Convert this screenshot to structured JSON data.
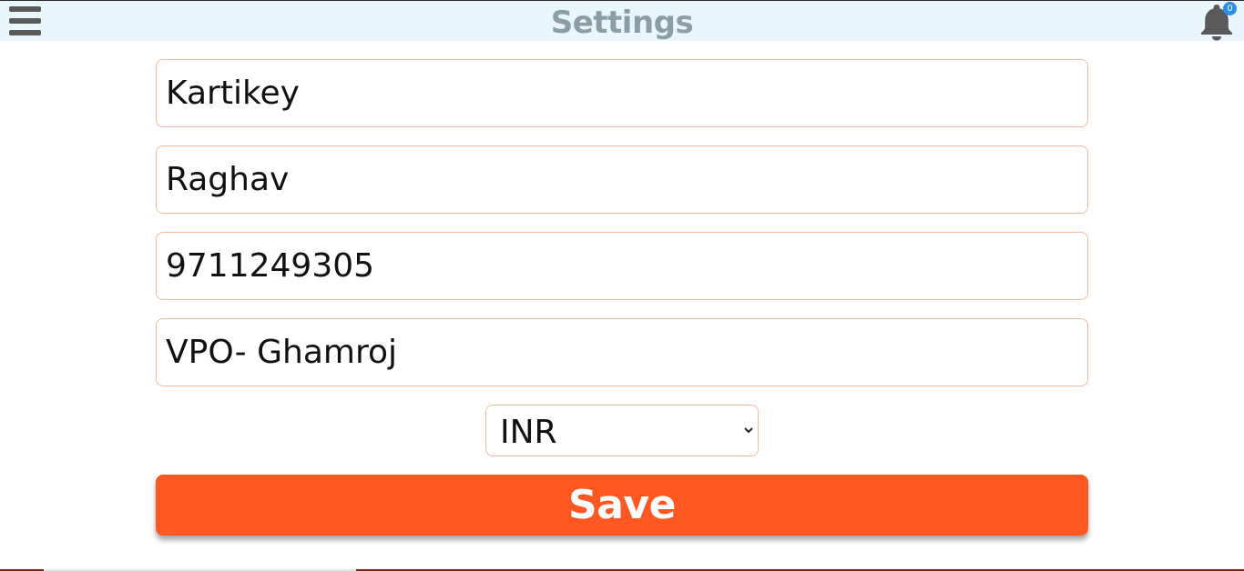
{
  "header": {
    "title": "Settings",
    "menu_icon": "hamburger-menu-icon",
    "notification_icon": "bell-icon",
    "notification_count": "0"
  },
  "form": {
    "first_name": "Kartikey",
    "last_name": "Raghav",
    "phone": "9711249305",
    "address": "VPO- Ghamroj",
    "currency": "INR",
    "save_label": "Save"
  },
  "colors": {
    "header_bg": "#e9f6fc",
    "title": "#8a9ea8",
    "field_border": "#f3b9a1",
    "save_button": "#ff5722",
    "badge": "#2a8ee6",
    "icon": "#5a5a5a"
  }
}
